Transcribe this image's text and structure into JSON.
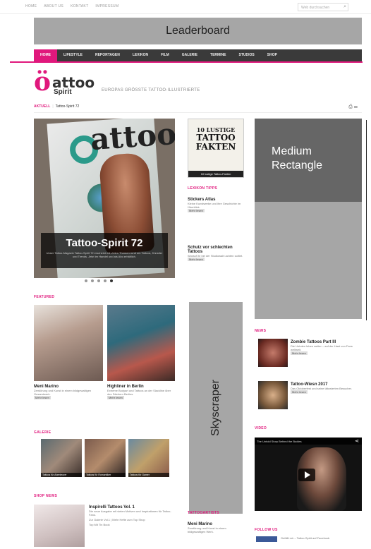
{
  "topbar": {
    "links": [
      "HOME",
      "ABOUT US",
      "KONTAKT",
      "IMPRESSUM"
    ],
    "search_placeholder": "Web durchsuchen"
  },
  "ads": {
    "leaderboard": "Leaderboard",
    "medium_rectangle": "Medium Rectangle",
    "skyscraper": "Skyscraper"
  },
  "nav": {
    "items": [
      "HOME",
      "LIFESTYLE",
      "REPORTAGEN",
      "LEXIKON",
      "FILM",
      "GALERIE",
      "TERMINE",
      "STUDIOS",
      "SHOP"
    ]
  },
  "brand": {
    "logo_mark": "ö",
    "logo_word": "attoo",
    "logo_sub": "Spirit",
    "tagline": "EUROPAS GRÖSSTE TATTOO-ILLUSTRIERTE"
  },
  "breadcrumb": {
    "section": "AKTUELL",
    "current": "Tattoo-Spirit 72"
  },
  "slider": {
    "mag_title": "attoo",
    "title": "Tattoo-Spirit 72",
    "desc": "Unser Tattoo-Magazin Tattoo-Spirit 72 erscheint mit vielen Themen rund um Tattoos, Künstler und Trends. Jetzt im Handel und als Abo erhältlich."
  },
  "left_sections": {
    "featured_label": "FEATURED",
    "cards": [
      {
        "title": "Meni Marino",
        "desc": "Zerstörung und Kunst in einem bildgewaltigen Gesamtwerk.",
        "more": "Mehr lesen"
      },
      {
        "title": "Highliner in Berlin",
        "desc": "Extreme Bodyart und Tattoos an der Slackline über den Dächern Berlins.",
        "more": "Mehr lesen"
      }
    ],
    "gallery_label": "GALERIE",
    "thumbs": [
      "Tattoos für Abenteurer",
      "Tattoos für Romantiker",
      "Tattoos für Gamer"
    ],
    "shop_label": "SHOP NEWS",
    "shop_title": "Inspirelli Tattoos Vol. 1",
    "shop_desc": "Die neue Ausgabe mit vielen Motiven und Inspirationen für Tattoo-Fans.",
    "shop_line2": "Zur Galerie Vol.1 | Mehr Hefte zum Top Shop",
    "shop_line3": "Top Mit Tin Book"
  },
  "mid": {
    "ad_title": "10 LUSTIGE",
    "ad_word1": "TATTOO",
    "ad_word2": "FAKTEN",
    "ad_caption": "10 lustige Tattoo-Fakten",
    "section": "LEXIKON TIPPS",
    "items": [
      {
        "title": "Stickers Atlas",
        "desc": "Kleine Kunstwerke und ihre Geschichte im Überblick.",
        "more": "Mehr lesen"
      },
      {
        "title": "Schutz vor schlechten Tattoos",
        "desc": "Worauf ihr bei der Studiowahl achten solltet.",
        "more": "Mehr lesen"
      }
    ],
    "bottom_section": "TATTOOARTISTS",
    "bottom_title": "Meni Marino",
    "bottom_desc": "Zerstörung und Kunst in einem bildgewaltigen Werk."
  },
  "right": {
    "news_label": "NEWS",
    "news": [
      {
        "title": "Zombie Tattoos Part III",
        "desc": "Die Untoten leben weiter – auf der Haut von Fans weltweit.",
        "more": "Mehr lesen"
      },
      {
        "title": "Tattoo-Wiesn 2017",
        "desc": "Das Oktoberfest und seine tätowierten Besucher.",
        "more": "Mehr lesen"
      }
    ],
    "video_label": "VIDEO",
    "video_title": "The Untold Story Behind the Bodies",
    "follow_label": "FOLLOW US",
    "follow_text": "Gefällt mir – Tattoo-Spirit auf Facebook"
  },
  "colors": {
    "accent": "#e0187c",
    "nav_bg": "#3a3a3a",
    "ad_gray": "#a6a6a6"
  },
  "icons": [
    "search-icon",
    "print-icon",
    "rss-icon",
    "play-icon",
    "share-icon"
  ]
}
